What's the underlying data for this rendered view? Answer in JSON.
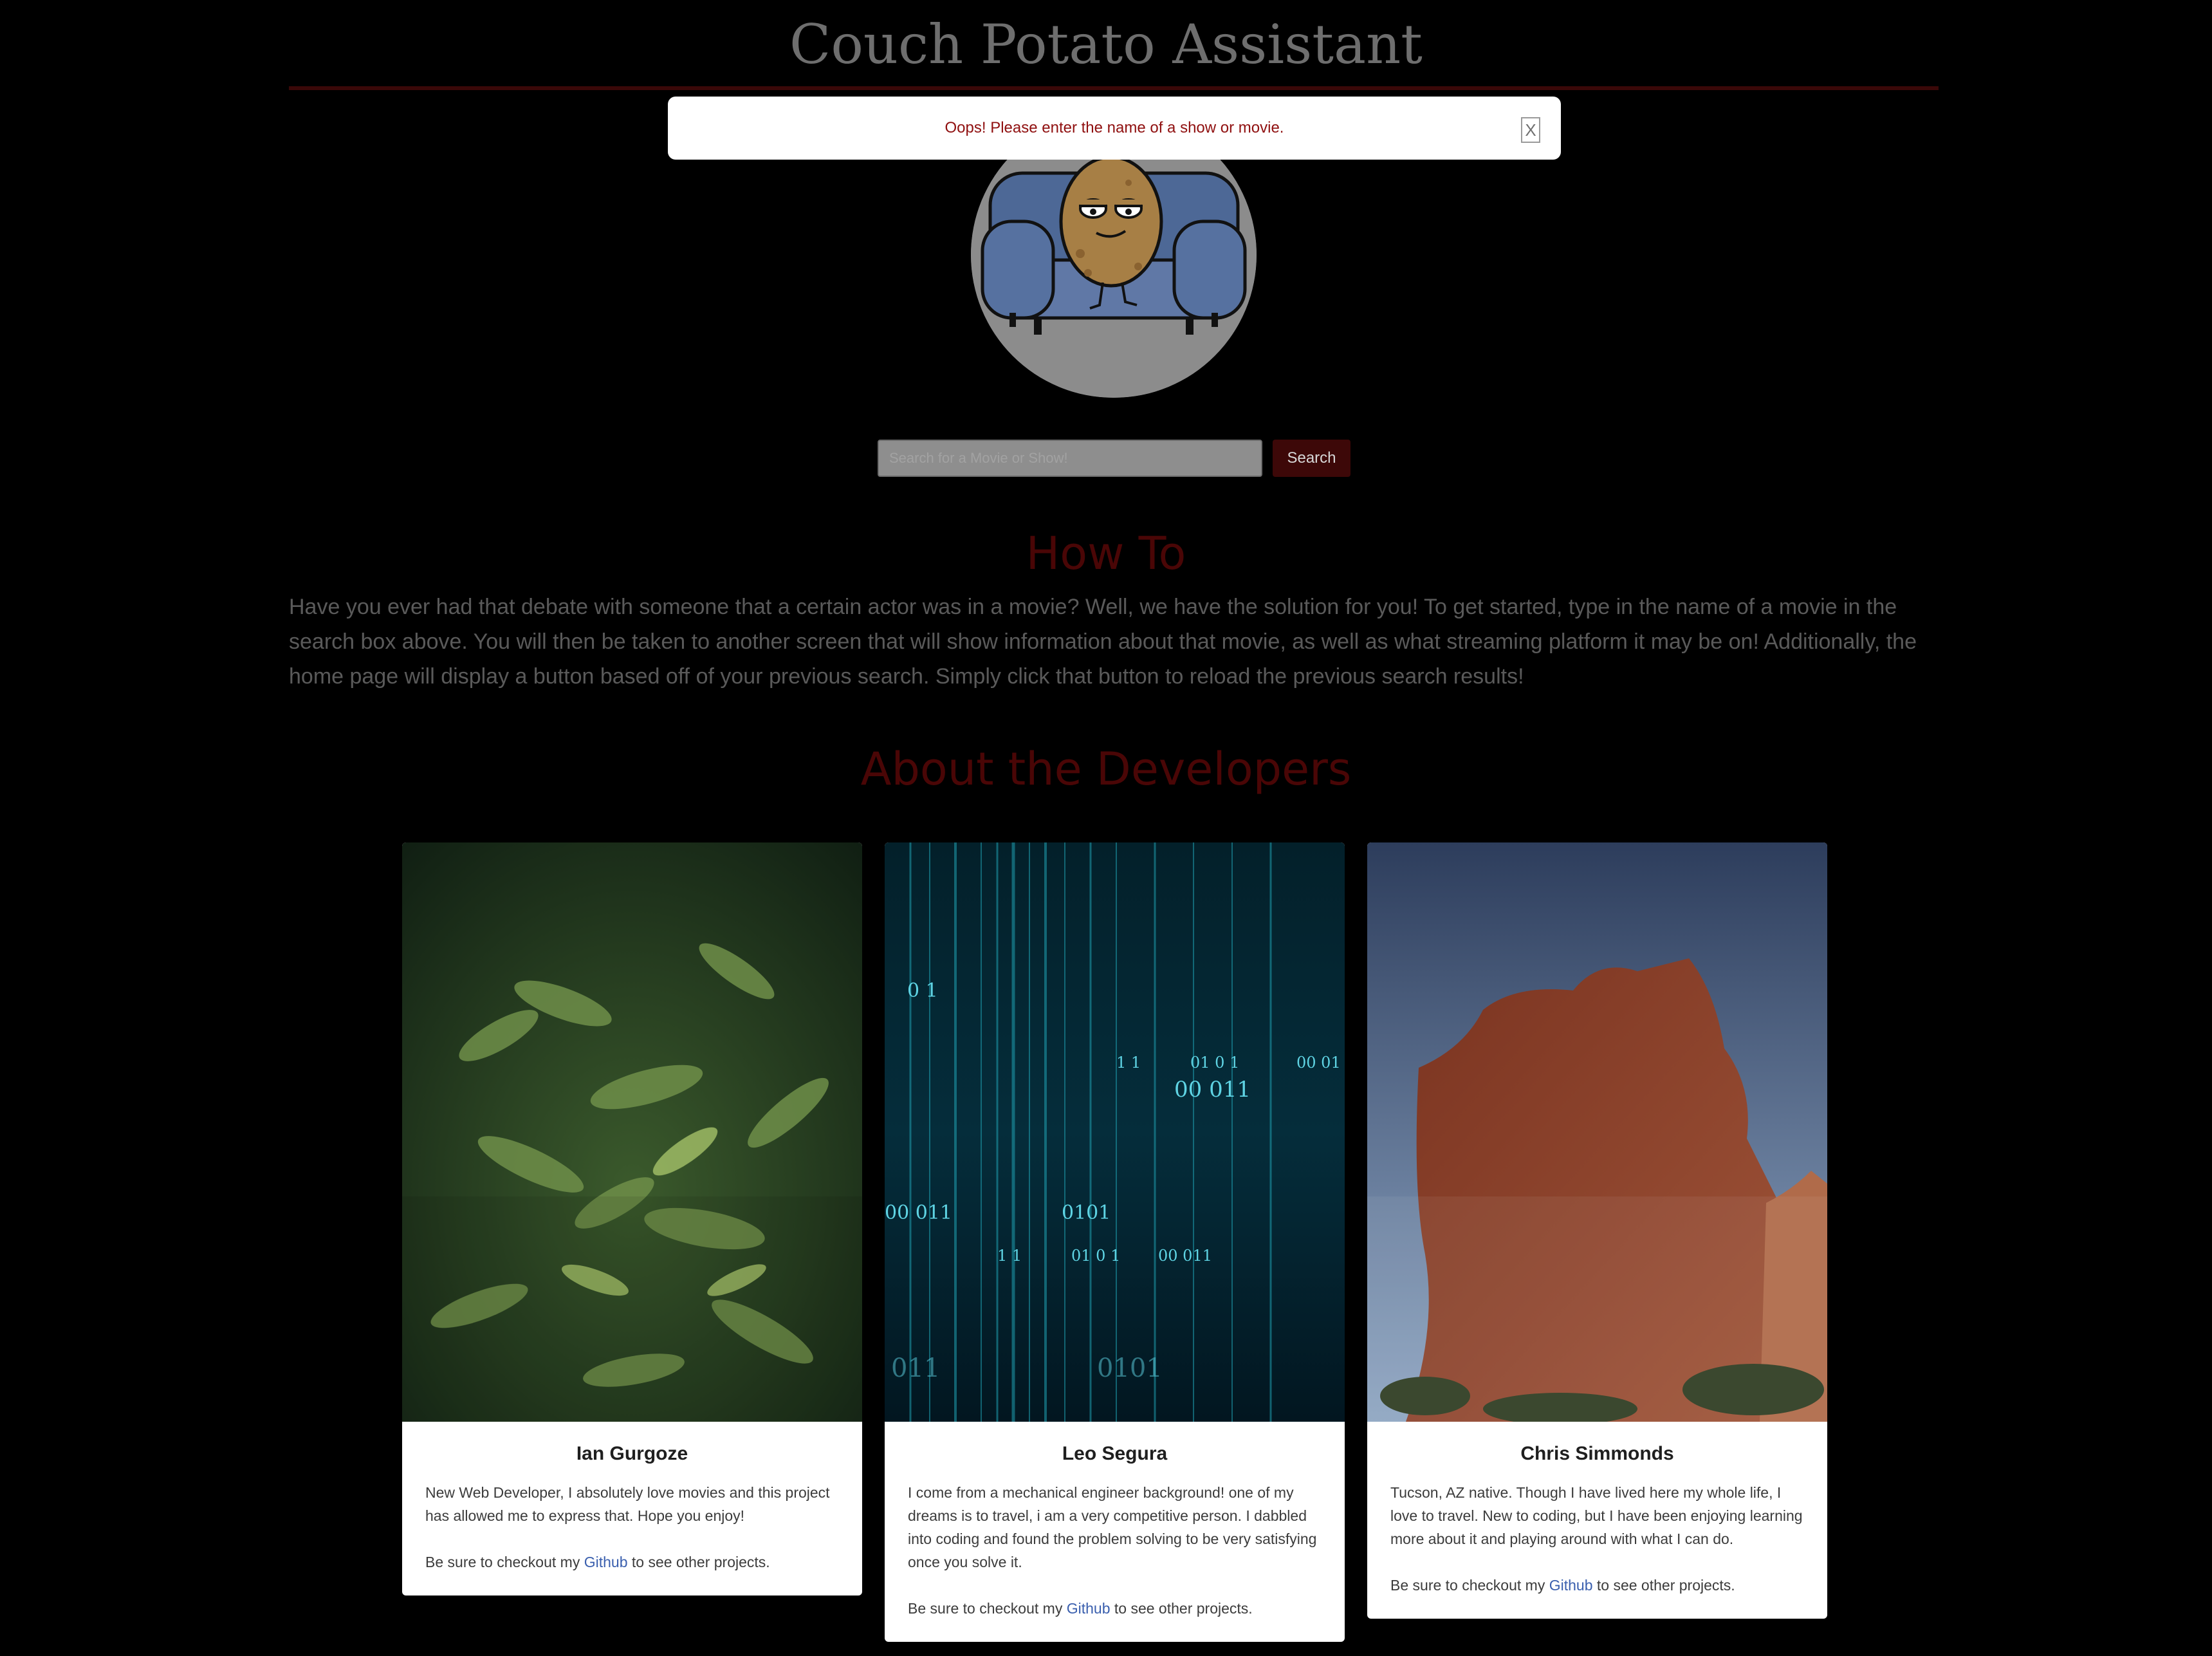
{
  "header": {
    "title": "Couch Potato Assistant"
  },
  "alert": {
    "message": "Oops! Please enter the name of a show or movie.",
    "close_label": "X"
  },
  "search": {
    "placeholder": "Search for a Movie or Show!",
    "value": "",
    "button_label": "Search"
  },
  "how_to": {
    "heading": "How To",
    "body": "Have you ever had that debate with someone that a certain actor was in a movie? Well, we have the solution for you! To get started, type in the name of a movie in the search box above. You will then be taken to another screen that will show information about that movie, as well as what streaming platform it may be on! Additionally, the home page will display a button based off of your previous search. Simply click that button to reload the previous search results!"
  },
  "developers": {
    "heading": "About the Developers",
    "cards": [
      {
        "name": "Ian Gurgoze",
        "bio": "New Web Developer, I absolutely love movies and this project has allowed me to express that. Hope you enjoy!",
        "link_prefix": "Be sure to checkout my ",
        "link_label": "Github",
        "link_suffix": " to see other projects.",
        "image": "fern-leaves-photo"
      },
      {
        "name": "Leo Segura",
        "bio": "I come from a mechanical engineer background! one of my dreams is to travel, i am a very competitive person. I dabbled into coding and found the problem solving to be very satisfying once you solve it.",
        "link_prefix": "Be sure to checkout my ",
        "link_label": "Github",
        "link_suffix": " to see other projects.",
        "image": "binary-code-photo",
        "image_text": [
          "0 1",
          "1 1",
          "01 0 1",
          "00 01",
          "00 011",
          "00 011",
          "0101",
          "1 1",
          "01 0 1",
          "00 011",
          "011",
          "0101"
        ]
      },
      {
        "name": "Chris Simmonds",
        "bio": "Tucson, AZ native. Though I have lived here my whole life, I love to travel. New to coding, but I have been enjoying learning more about it and playing around with what I can do.",
        "link_prefix": "Be sure to checkout my ",
        "link_label": "Github",
        "link_suffix": " to see other projects.",
        "image": "red-rock-photo"
      }
    ]
  },
  "colors": {
    "background": "#000000",
    "title": "#6e6e6e",
    "accent": "#4a0606",
    "alert_text": "#8f0f0f",
    "link": "#3a5fae"
  }
}
